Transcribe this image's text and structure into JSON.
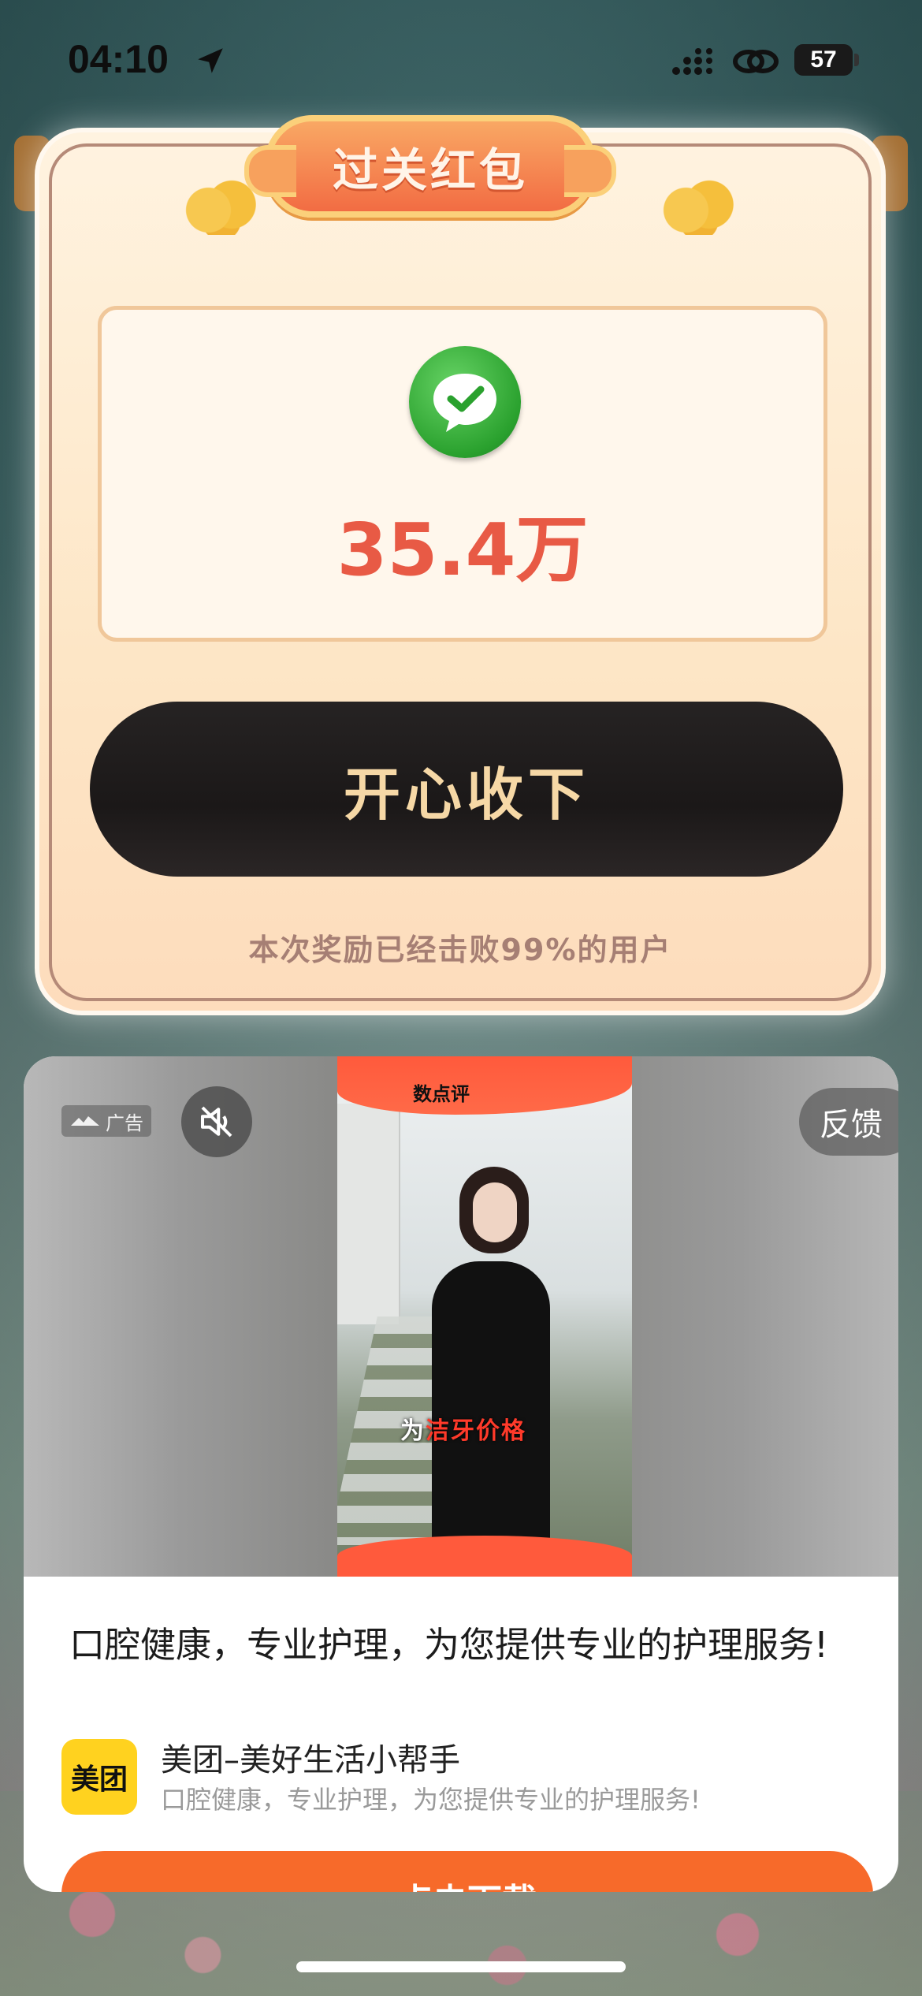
{
  "status_bar": {
    "time": "04:10",
    "battery": "57",
    "icons": [
      "location-arrow-icon",
      "signal-icon",
      "link-icon",
      "battery-icon"
    ]
  },
  "reward_dialog": {
    "title": "过关红包",
    "amount": "35.4万",
    "claim_button": "开心收下",
    "beat_text": "本次奖励已经击败99%的用户",
    "icon": "wechat-check-icon"
  },
  "ad": {
    "badge": "广告",
    "feedback": "反馈",
    "video_top_title": "数点评",
    "video_caption_white": "为",
    "video_caption_red": "洁牙价格",
    "headline": "口腔健康，专业护理，为您提供专业的护理服务!",
    "brand_logo": "美团",
    "brand_name": "美团–美好生活小帮手",
    "brand_desc": "口腔健康，专业护理，为您提供专业的护理服务!",
    "download": "点击下载"
  },
  "colors": {
    "amount": "#e85a45",
    "claim_text": "#f6d8a6",
    "download_bg": "#f76a2a",
    "brand_logo_bg": "#ffd21f"
  }
}
